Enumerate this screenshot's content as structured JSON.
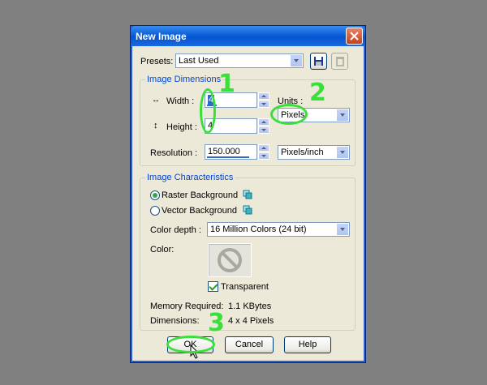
{
  "dialog": {
    "title": "New Image",
    "presets_label": "Presets:",
    "presets_value": "Last Used",
    "dimensions": {
      "group_title": "Image Dimensions",
      "width_label": "Width :",
      "width_value": "4",
      "height_label": "Height :",
      "height_value": "4",
      "units_label": "Units :",
      "units_value": "Pixels",
      "resolution_label": "Resolution :",
      "resolution_value": "150.000",
      "resolution_units": "Pixels/inch"
    },
    "characteristics": {
      "group_title": "Image Characteristics",
      "raster_label": "Raster Background",
      "vector_label": "Vector Background",
      "selected_background": "raster",
      "color_depth_label": "Color depth :",
      "color_depth_value": "16 Million Colors (24 bit)",
      "color_label": "Color:",
      "transparent_label": "Transparent",
      "transparent_checked": true,
      "memory_label": "Memory Required:",
      "memory_value": "1.1 KBytes",
      "dims_label": "Dimensions:",
      "dims_value": "4 x 4 Pixels"
    },
    "buttons": {
      "ok": "OK",
      "cancel": "Cancel",
      "help": "Help"
    }
  },
  "annotations": {
    "one": "1",
    "two": "2",
    "three": "3",
    "color": "#3ae03a"
  },
  "colors": {
    "title_bar": "#0554d0",
    "dialog_bg": "#ece9d8",
    "group_title": "#0046d5",
    "desktop": "#808080"
  }
}
